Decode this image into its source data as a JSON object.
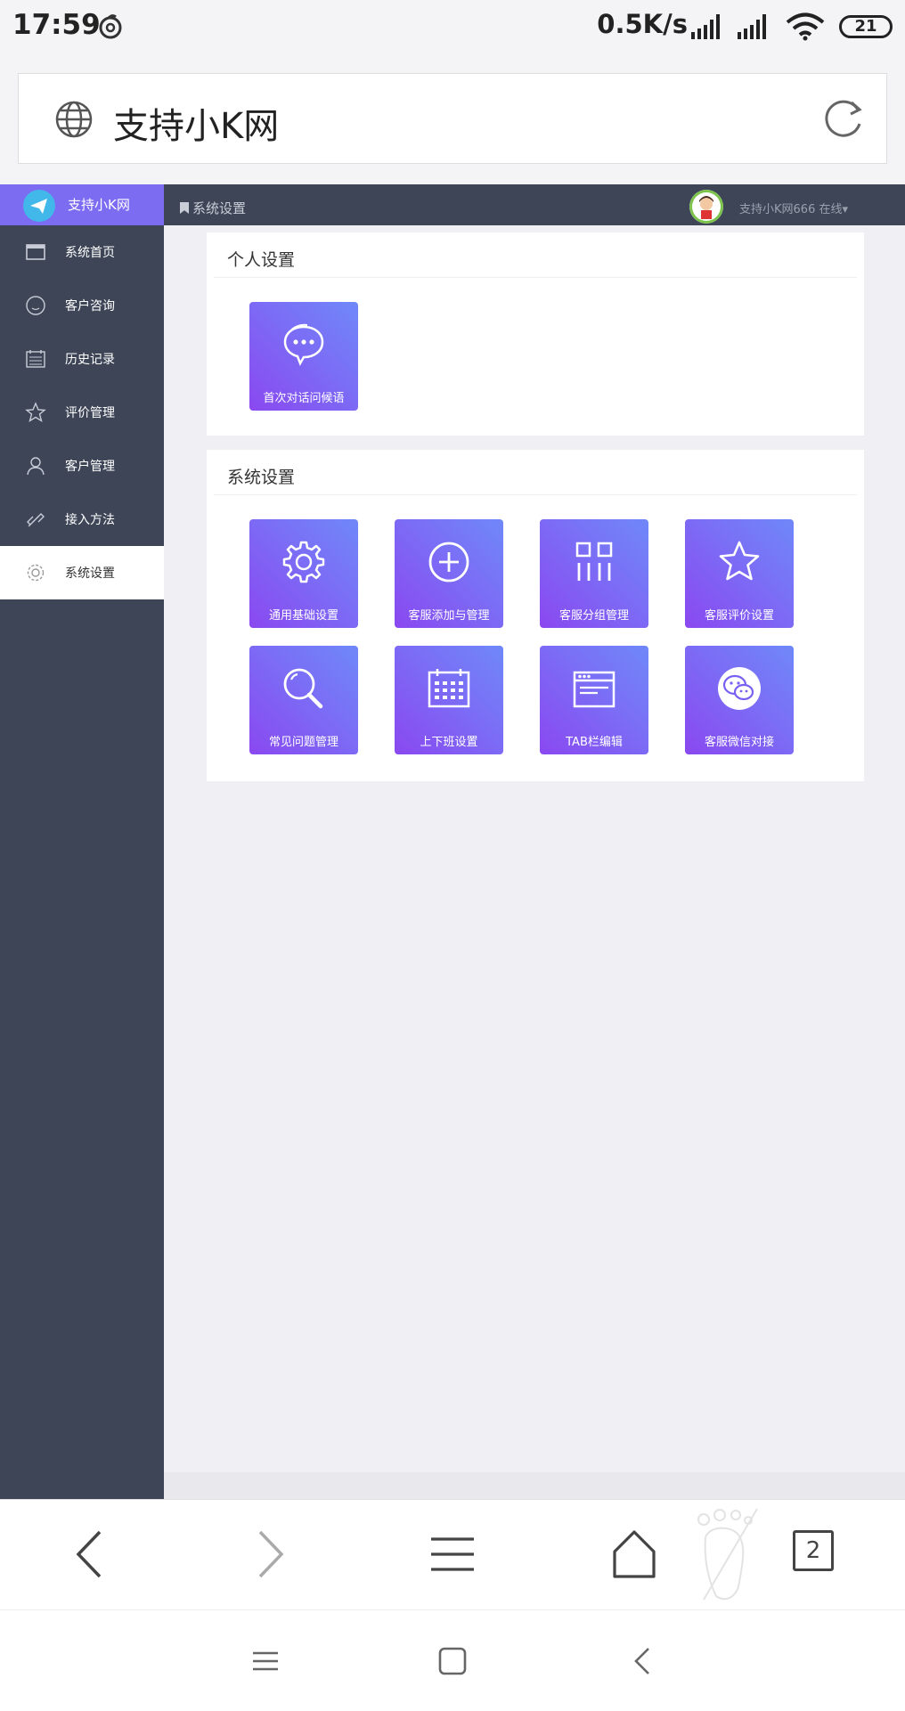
{
  "status_bar": {
    "time": "17:59",
    "net_speed": "0.5K/s",
    "battery": "21"
  },
  "browser": {
    "page_title": "支持小K网",
    "tab_count": "2"
  },
  "app": {
    "brand": "支持小K网",
    "breadcrumb": "系统设置",
    "user_label": "支持小K网666 在线",
    "accent_color": "#7c6cf2",
    "sidebar_color": "#3d4557"
  },
  "sidebar": {
    "items": [
      {
        "label": "系统首页",
        "icon": "window-icon"
      },
      {
        "label": "客户咨询",
        "icon": "smile-icon"
      },
      {
        "label": "历史记录",
        "icon": "calendar-list-icon"
      },
      {
        "label": "评价管理",
        "icon": "star-icon"
      },
      {
        "label": "客户管理",
        "icon": "user-icon"
      },
      {
        "label": "接入方法",
        "icon": "link-icon"
      },
      {
        "label": "系统设置",
        "icon": "gear-icon",
        "active": true
      }
    ]
  },
  "sections": {
    "personal": {
      "title": "个人设置",
      "tiles": [
        {
          "label": "首次对话问候语",
          "icon": "chat-bubble-icon"
        }
      ]
    },
    "system": {
      "title": "系统设置",
      "tiles": [
        {
          "label": "通用基础设置",
          "icon": "gear-icon"
        },
        {
          "label": "客服添加与管理",
          "icon": "plus-circle-icon"
        },
        {
          "label": "客服分组管理",
          "icon": "group-grid-icon"
        },
        {
          "label": "客服评价设置",
          "icon": "star-icon"
        },
        {
          "label": "常见问题管理",
          "icon": "magnifier-icon"
        },
        {
          "label": "上下班设置",
          "icon": "calendar-icon"
        },
        {
          "label": "TAB栏编辑",
          "icon": "browser-window-icon"
        },
        {
          "label": "客服微信对接",
          "icon": "wechat-icon"
        }
      ]
    }
  }
}
